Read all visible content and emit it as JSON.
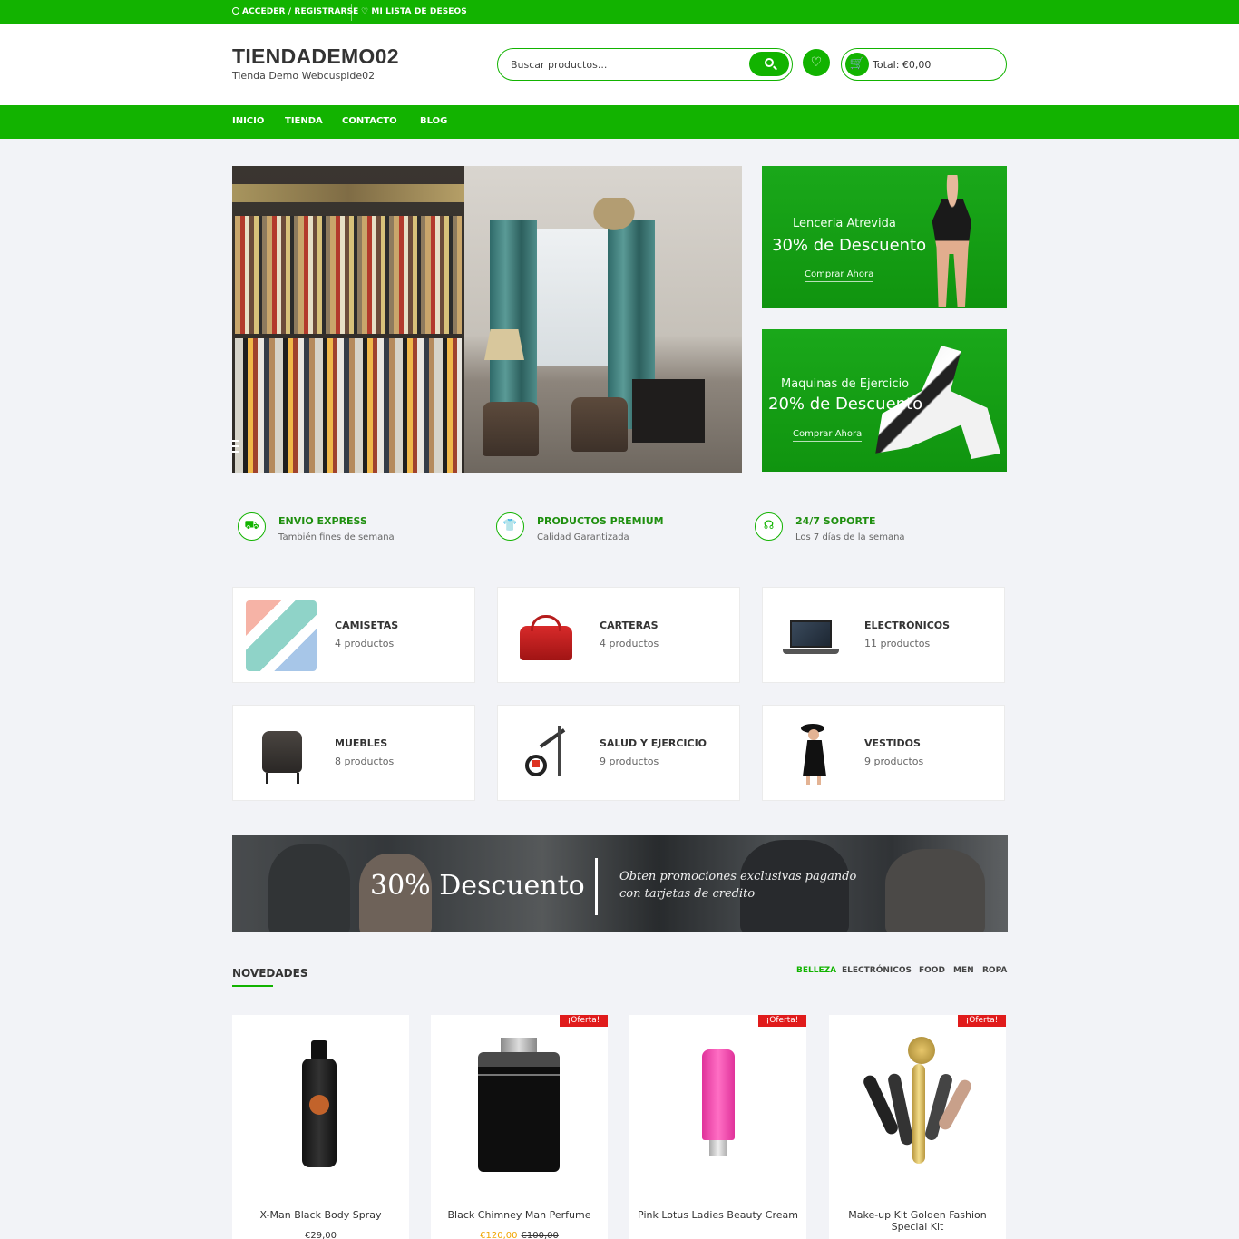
{
  "topbar": {
    "login": "ACCEDER / REGISTRARSE",
    "wishlist": "MI LISTA DE DESEOS"
  },
  "header": {
    "site_title": "TIENDADEMO02",
    "tagline": "Tienda Demo Webcuspide02",
    "search_placeholder": "Buscar productos...",
    "cart_total": "Total: €0,00"
  },
  "nav": {
    "items": [
      "INICIO",
      "TIENDA",
      "CONTACTO",
      "BLOG"
    ]
  },
  "promos": [
    {
      "subtitle": "Lenceria Atrevida",
      "title": "30% de Descuento",
      "link": "Comprar Ahora"
    },
    {
      "subtitle": "Maquinas de Ejercicio",
      "title": "20% de Descuento",
      "link": "Comprar Ahora"
    }
  ],
  "features": [
    {
      "icon": "truck-icon",
      "title": "ENVIO EXPRESS",
      "subtitle": "También fines de semana"
    },
    {
      "icon": "tshirt-icon",
      "title": "PRODUCTOS PREMIUM",
      "subtitle": "Calidad Garantizada"
    },
    {
      "icon": "headset-icon",
      "title": "24/7 SOPORTE",
      "subtitle": "Los 7 días de la semana"
    }
  ],
  "categories": [
    {
      "name": "CAMISETAS",
      "count": "4 productos"
    },
    {
      "name": "CARTERAS",
      "count": "4 productos"
    },
    {
      "name": "ELECTRÓNICOS",
      "count": "11 productos"
    },
    {
      "name": "MUEBLES",
      "count": "8 productos"
    },
    {
      "name": "SALUD Y EJERCICIO",
      "count": "9 productos"
    },
    {
      "name": "VESTIDOS",
      "count": "9 productos"
    }
  ],
  "banner": {
    "title": "30% Descuento",
    "line1": "Obten promociones exclusivas pagando",
    "line2": "con tarjetas de credito"
  },
  "novedades": {
    "title": "NOVEDADES",
    "tabs": [
      "BELLEZA",
      "ELECTRÓNICOS",
      "FOOD",
      "MEN",
      "ROPA"
    ],
    "active_tab": "BELLEZA",
    "badge_label": "¡Oferta!",
    "products": [
      {
        "name": "X-Man Black Body Spray",
        "price": "€29,00",
        "sale_price": "",
        "on_sale": false
      },
      {
        "name": "Black Chimney Man Perfume",
        "price": "€100,00",
        "sale_price": "€120,00",
        "on_sale": true
      },
      {
        "name": "Pink Lotus Ladies Beauty Cream",
        "price": "",
        "sale_price": "",
        "on_sale": true
      },
      {
        "name": "Make-up Kit Golden Fashion Special Kit",
        "price": "",
        "sale_price": "",
        "on_sale": true
      }
    ]
  },
  "colors": {
    "brand": "#12b300",
    "sale_badge": "#e01b1b",
    "sale_price": "#f0a500"
  }
}
